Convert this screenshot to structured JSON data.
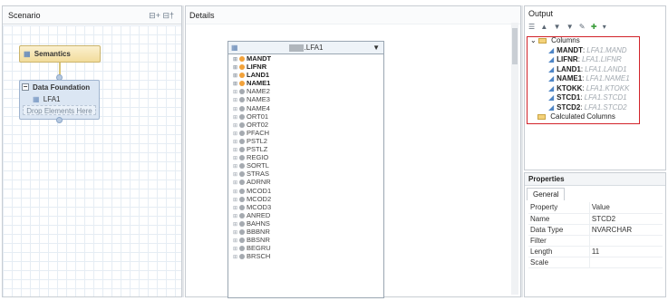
{
  "scenario": {
    "title": "Scenario",
    "header_tools": "⊟+ ⊟†",
    "semantics_label": "Semantics",
    "data_foundation_label": "Data Foundation",
    "table_label": "LFA1",
    "drop_label": "Drop Elements Here"
  },
  "details": {
    "title": "Details",
    "table_title_suffix": ".LFA1",
    "fields": [
      {
        "name": "MANDT",
        "key": true
      },
      {
        "name": "LIFNR",
        "key": true
      },
      {
        "name": "LAND1",
        "key": true
      },
      {
        "name": "NAME1",
        "key": true
      },
      {
        "name": "NAME2",
        "key": false
      },
      {
        "name": "NAME3",
        "key": false
      },
      {
        "name": "NAME4",
        "key": false
      },
      {
        "name": "ORT01",
        "key": false
      },
      {
        "name": "ORT02",
        "key": false
      },
      {
        "name": "PFACH",
        "key": false
      },
      {
        "name": "PSTL2",
        "key": false
      },
      {
        "name": "PSTLZ",
        "key": false
      },
      {
        "name": "REGIO",
        "key": false
      },
      {
        "name": "SORTL",
        "key": false
      },
      {
        "name": "STRAS",
        "key": false
      },
      {
        "name": "ADRNR",
        "key": false
      },
      {
        "name": "MCOD1",
        "key": false
      },
      {
        "name": "MCOD2",
        "key": false
      },
      {
        "name": "MCOD3",
        "key": false
      },
      {
        "name": "ANRED",
        "key": false
      },
      {
        "name": "BAHNS",
        "key": false
      },
      {
        "name": "BBBNR",
        "key": false
      },
      {
        "name": "BBSNR",
        "key": false
      },
      {
        "name": "BEGRU",
        "key": false
      },
      {
        "name": "BRSCH",
        "key": false
      }
    ]
  },
  "output": {
    "title": "Output",
    "columns_group": "Columns",
    "calculated_group": "Calculated Columns",
    "columns": [
      {
        "name": "MANDT",
        "source": "LFA1.MAND"
      },
      {
        "name": "LIFNR",
        "source": "LFA1.LIFNR"
      },
      {
        "name": "LAND1",
        "source": "LFA1.LAND1"
      },
      {
        "name": "NAME1",
        "source": "LFA1.NAME1"
      },
      {
        "name": "KTOKK",
        "source": "LFA1.KTOKK"
      },
      {
        "name": "STCD1",
        "source": "LFA1.STCD1"
      },
      {
        "name": "STCD2",
        "source": "LFA1.STCD2"
      }
    ]
  },
  "properties": {
    "title": "Properties",
    "tab": "General",
    "header_property": "Property",
    "header_value": "Value",
    "rows": [
      {
        "property": "Name",
        "value": "STCD2"
      },
      {
        "property": "Data Type",
        "value": "NVARCHAR"
      },
      {
        "property": "Filter",
        "value": ""
      },
      {
        "property": "Length",
        "value": "11"
      },
      {
        "property": "Scale",
        "value": ""
      }
    ]
  },
  "colors": {
    "key_field": "#f2a23a",
    "highlight": "#d2232a"
  }
}
